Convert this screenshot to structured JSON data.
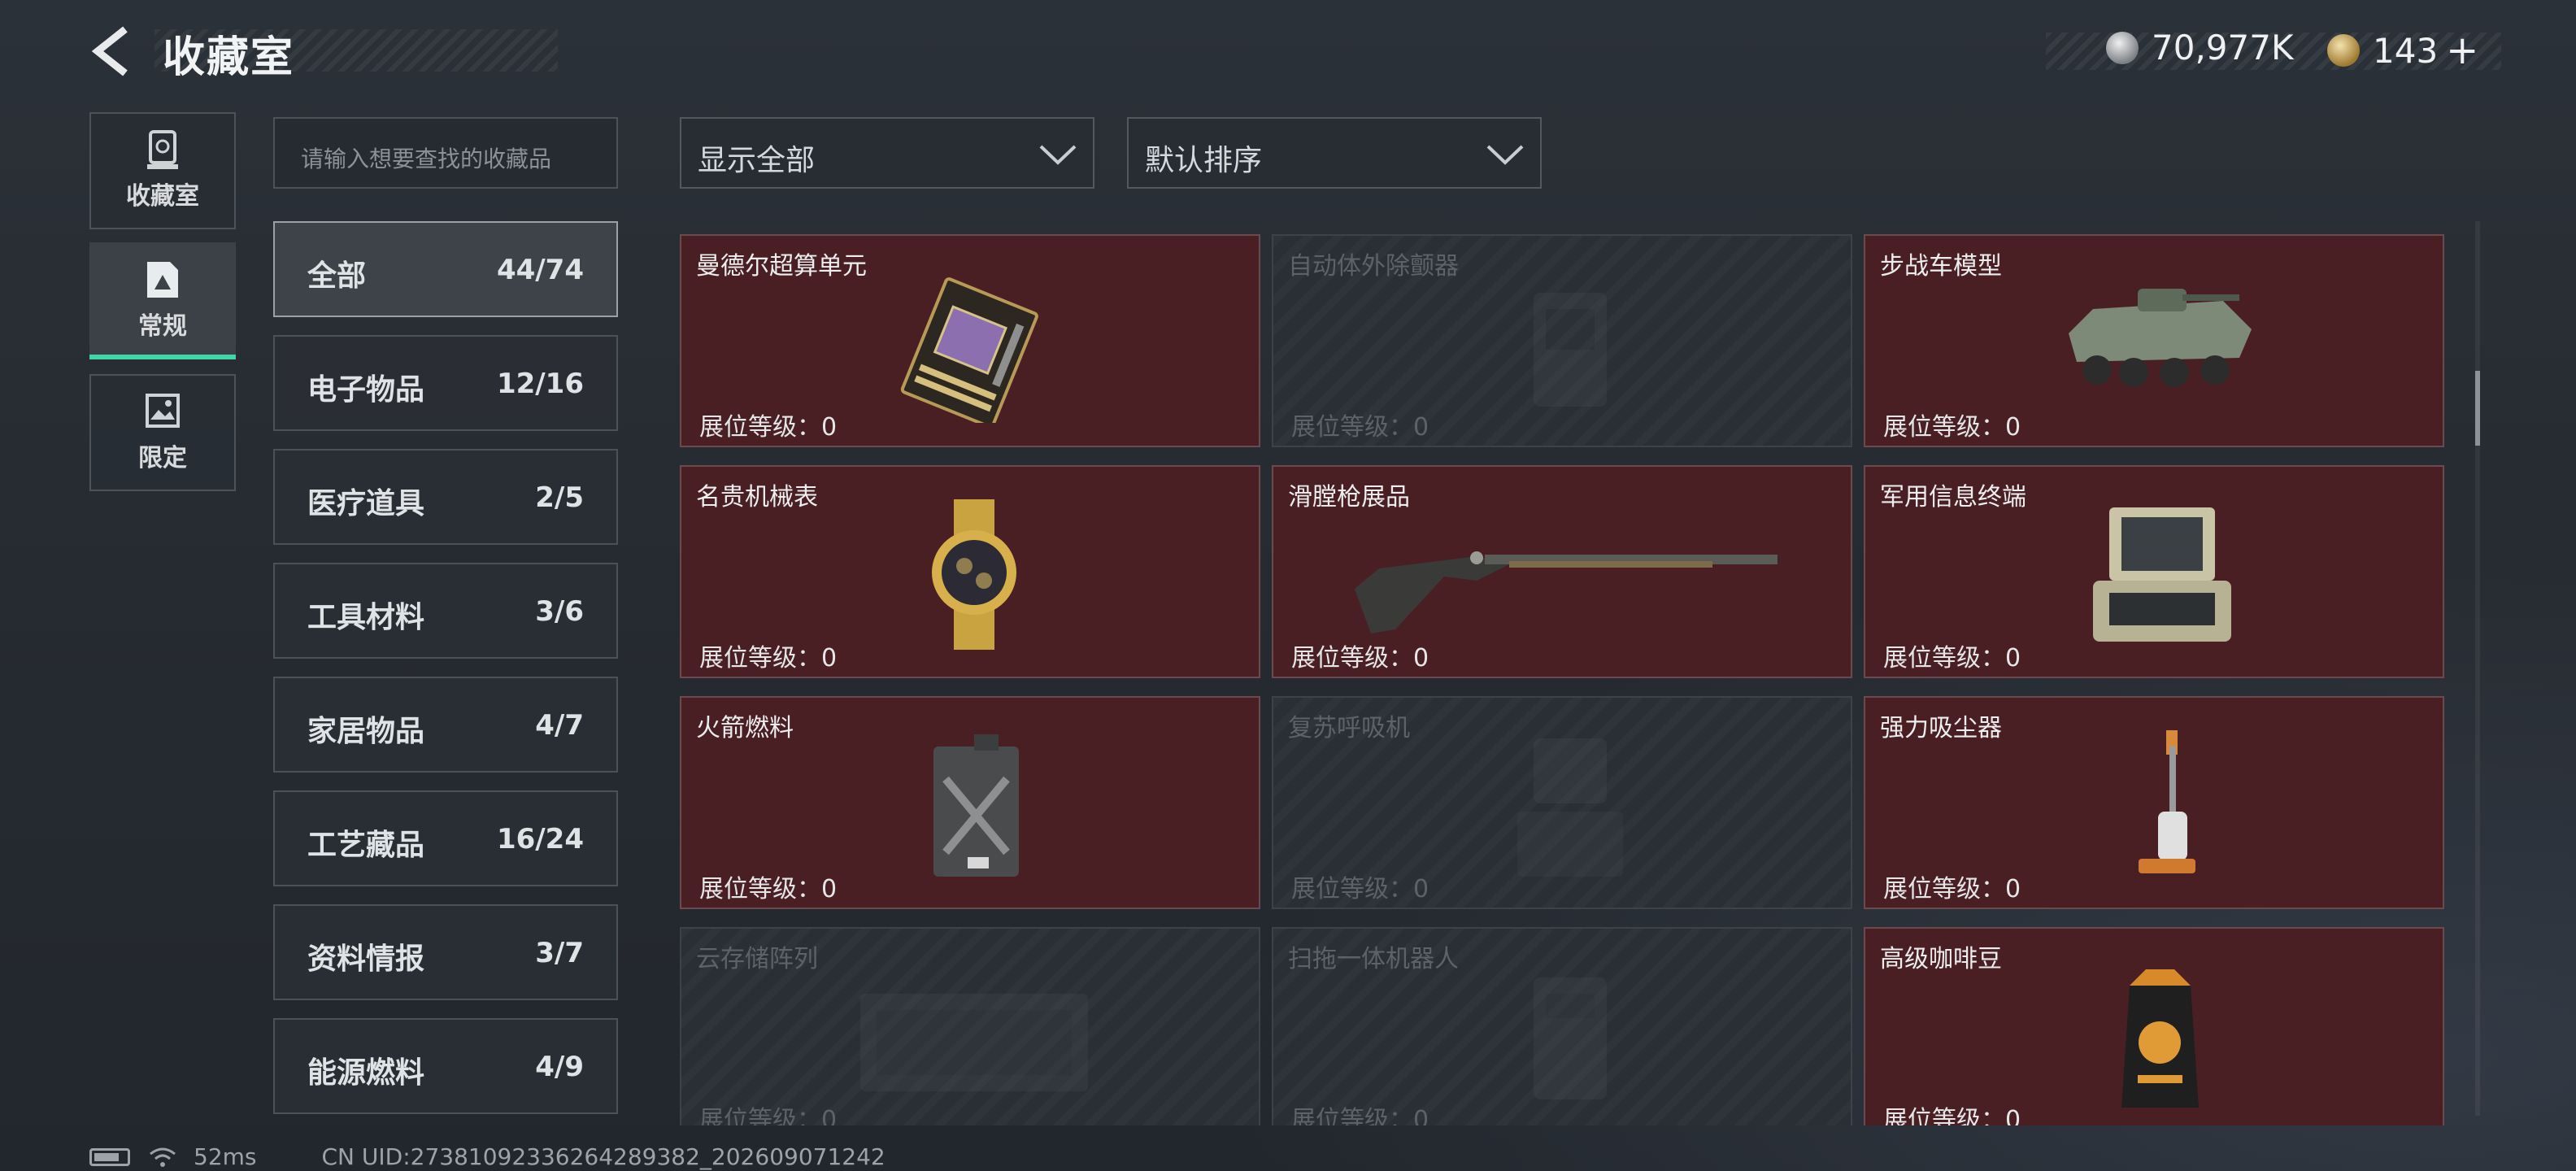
{
  "header": {
    "title": "收藏室",
    "currency_silver": "70,977K",
    "currency_gold": "143",
    "add_symbol": "+"
  },
  "side_tabs": [
    {
      "label": "收藏室",
      "icon": "trophy-icon",
      "active": false
    },
    {
      "label": "常规",
      "icon": "picture-icon",
      "active": true
    },
    {
      "label": "限定",
      "icon": "image-frame-icon",
      "active": false
    }
  ],
  "search": {
    "placeholder": "请输入想要查找的收藏品"
  },
  "categories": [
    {
      "name": "全部",
      "count": "44/74",
      "active": true
    },
    {
      "name": "电子物品",
      "count": "12/16"
    },
    {
      "name": "医疗道具",
      "count": "2/5"
    },
    {
      "name": "工具材料",
      "count": "3/6"
    },
    {
      "name": "家居物品",
      "count": "4/7"
    },
    {
      "name": "工艺藏品",
      "count": "16/24"
    },
    {
      "name": "资料情报",
      "count": "3/7"
    },
    {
      "name": "能源燃料",
      "count": "4/9"
    }
  ],
  "filters": {
    "display": "显示全部",
    "sort": "默认排序"
  },
  "level_label": "展位等级：0",
  "items": [
    {
      "name": "曼德尔超算单元",
      "owned": true,
      "icon": "circuit-board-icon"
    },
    {
      "name": "自动体外除颤器",
      "owned": false,
      "icon": "defibrillator-icon"
    },
    {
      "name": "步战车模型",
      "owned": true,
      "icon": "armored-vehicle-icon"
    },
    {
      "name": "名贵机械表",
      "owned": true,
      "icon": "wristwatch-icon"
    },
    {
      "name": "滑膛枪展品",
      "owned": true,
      "icon": "musket-icon"
    },
    {
      "name": "军用信息终端",
      "owned": true,
      "icon": "rugged-terminal-icon"
    },
    {
      "name": "火箭燃料",
      "owned": true,
      "icon": "jerrycan-icon"
    },
    {
      "name": "复苏呼吸机",
      "owned": false,
      "icon": "ventilator-icon"
    },
    {
      "name": "强力吸尘器",
      "owned": true,
      "icon": "vacuum-cleaner-icon"
    },
    {
      "name": "云存储阵列",
      "owned": false,
      "icon": "storage-array-icon"
    },
    {
      "name": "扫拖一体机器人",
      "owned": false,
      "icon": "robot-mop-icon"
    },
    {
      "name": "高级咖啡豆",
      "owned": true,
      "icon": "coffee-bag-icon"
    }
  ],
  "status_bar": {
    "ping": "52ms",
    "uid": "CN UID:273810923362642893​82_202609071242"
  }
}
